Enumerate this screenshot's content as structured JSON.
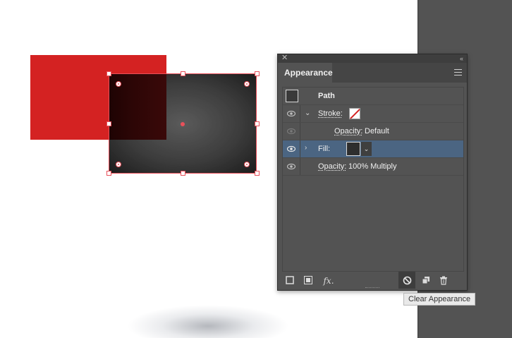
{
  "canvas": {
    "shape_colors": {
      "red": "#d42222",
      "selection": "#e8505a"
    }
  },
  "panel": {
    "title": "Appearance",
    "rows": [
      {
        "label": "Path",
        "value": ""
      },
      {
        "label": "Stroke:",
        "value": ""
      },
      {
        "label": "Opacity:",
        "value": "Default"
      },
      {
        "label": "Fill:",
        "value": ""
      },
      {
        "label": "Opacity:",
        "value": "100% Multiply"
      }
    ],
    "bottom_icons": [
      "add-new-stroke-icon",
      "add-new-fill-icon",
      "add-new-effect-icon",
      "clear-appearance-icon",
      "duplicate-item-icon",
      "delete-item-icon"
    ],
    "fx_label": "fx."
  },
  "tooltip": {
    "text": "Clear Appearance"
  }
}
